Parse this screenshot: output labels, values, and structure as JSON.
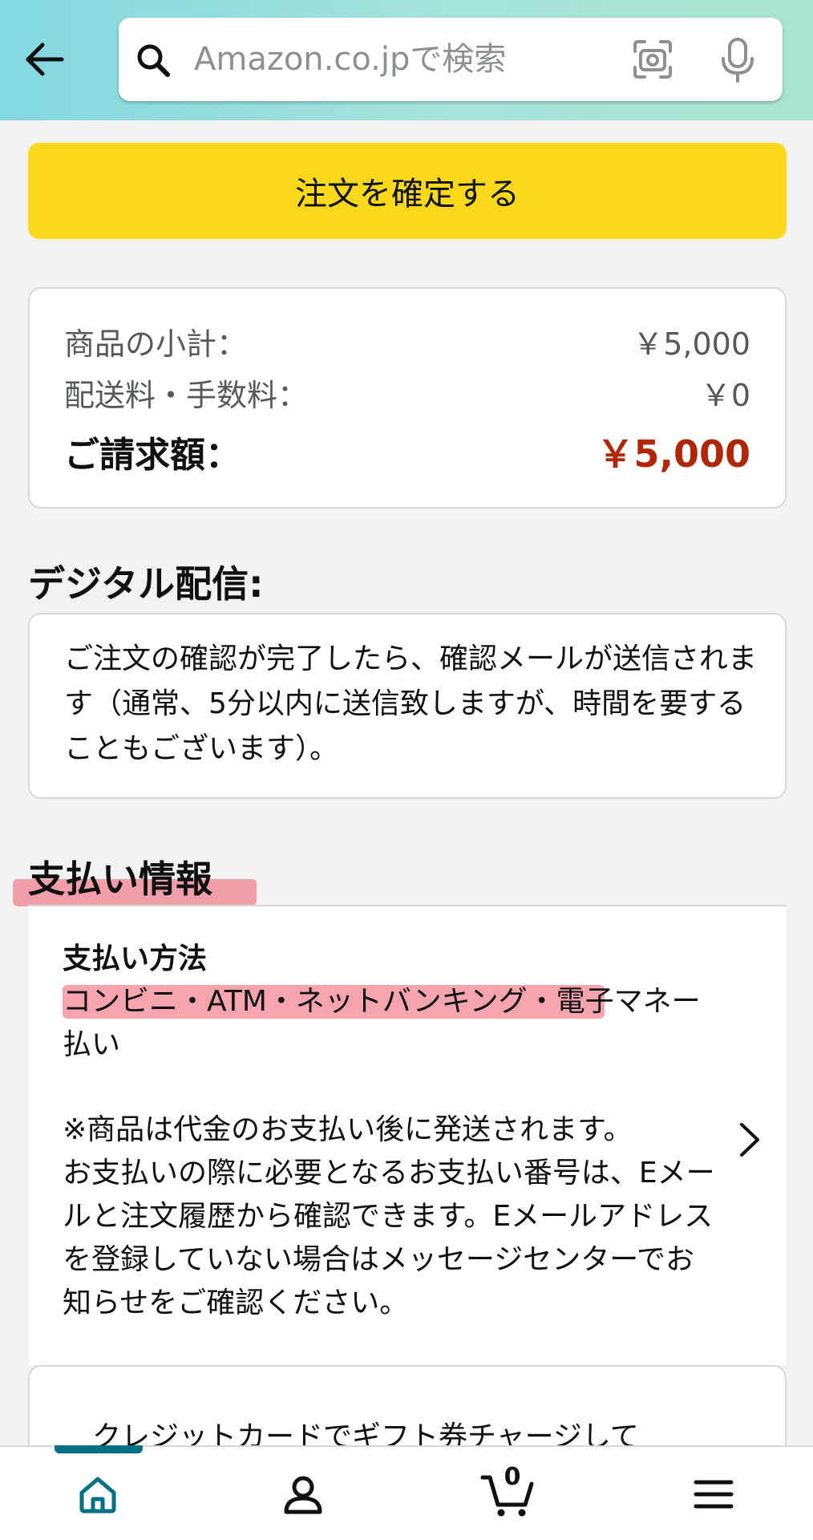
{
  "header": {
    "search_placeholder": "Amazon.co.jpで検索",
    "icons": [
      "back-arrow-icon",
      "search-icon",
      "camera-icon",
      "microphone-icon"
    ]
  },
  "place_order": {
    "label": "注文を確定する"
  },
  "summary": {
    "subtotal_label": "商品の小計：",
    "subtotal_value": "￥5,000",
    "shipping_label": "配送料・手数料：",
    "shipping_value": "￥0",
    "total_label": "ご請求額：",
    "total_value": "￥5,000"
  },
  "digital": {
    "title": "デジタル配信:",
    "body": "ご注文の確認が完了したら、確認メールが送信されます（通常、5分以内に送信致しますが、時間を要することもございます）。"
  },
  "payment": {
    "title": "支払い情報",
    "method_label": "支払い方法",
    "method_highlighted": "コンビニ・ATM・ネットバンキング",
    "method_rest": "・電子マネー払い",
    "note_line1": "※商品は代金のお支払い後に発送されます。",
    "note_rest": "お支払いの際に必要となるお支払い番号は、Eメールと注文履歴から確認できます。Eメールアドレスを登録していない場合はメッセージセンターでお知らせをご確認ください。"
  },
  "promo": {
    "text": "クレジットカードでギフト券チャージして"
  },
  "bottom_nav": {
    "active": "home",
    "cart_count": "0",
    "items": [
      "home-icon",
      "account-icon",
      "cart-icon",
      "menu-icon"
    ]
  },
  "colors": {
    "header_gradient_start": "#84d8e1",
    "header_gradient_end": "#a8e4cf",
    "button_yellow": "#fcd81d",
    "price_red": "#b12704",
    "highlight_pink": "#f05a6e",
    "nav_active_teal": "#007185"
  }
}
